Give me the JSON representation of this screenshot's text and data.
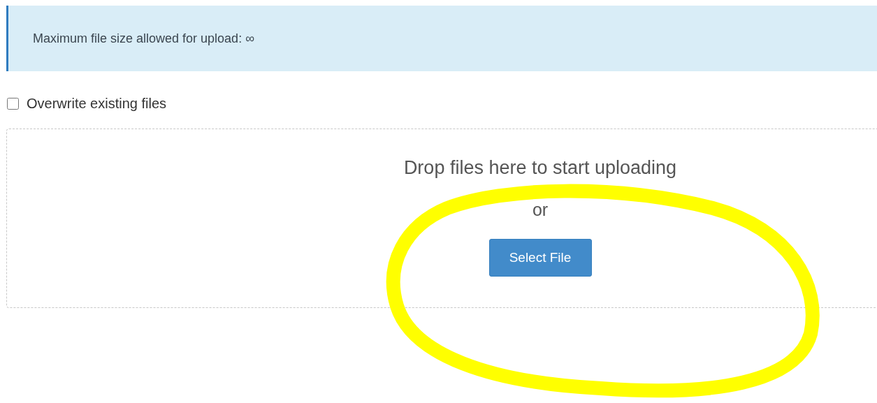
{
  "alert": {
    "text": "Maximum file size allowed for upload: ∞"
  },
  "overwrite": {
    "label": "Overwrite existing files",
    "checked": false
  },
  "dropzone": {
    "message": "Drop files here to start uploading",
    "separator": "or",
    "button": "Select File"
  }
}
